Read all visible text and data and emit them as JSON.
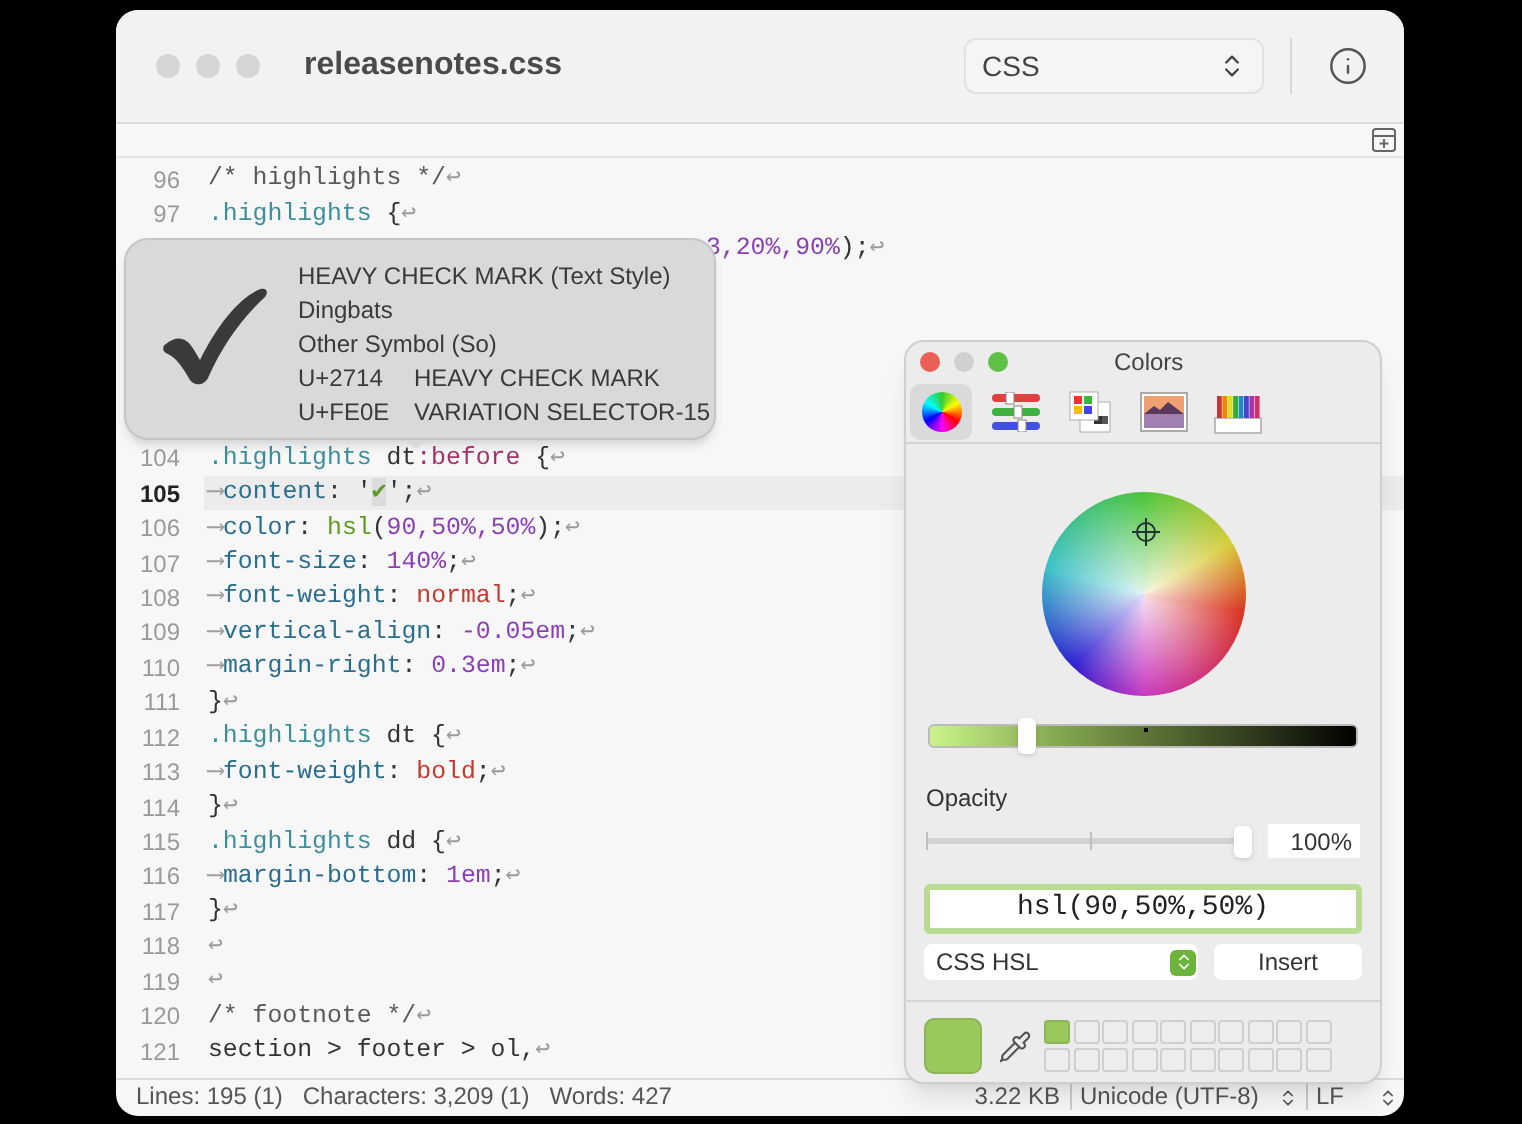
{
  "window": {
    "title": "releasenotes.css",
    "syntax": "CSS"
  },
  "lines": [
    {
      "number": "96",
      "current": false,
      "tokens": [
        {
          "text": "/* highlights */",
          "kind": "comment"
        },
        {
          "text": "↩",
          "kind": "eol"
        }
      ]
    },
    {
      "number": "97",
      "current": false,
      "tokens": [
        {
          "text": ".highlights",
          "kind": "selector"
        },
        {
          "text": " {",
          "kind": "plain"
        },
        {
          "text": "↩",
          "kind": "eol"
        }
      ]
    },
    {
      "covered": true,
      "current": false,
      "tokens": [
        {
          "text": "3,20%,90%",
          "kind": "number"
        },
        {
          "text": ");",
          "kind": "plain"
        },
        {
          "text": "↩",
          "kind": "eol"
        }
      ]
    },
    {
      "covered": true
    },
    {
      "covered": true
    },
    {
      "covered": true
    },
    {
      "covered": true
    },
    {
      "covered": true
    },
    {
      "number": "104",
      "current": false,
      "tokens": [
        {
          "text": ".highlights",
          "kind": "selector"
        },
        {
          "text": " dt",
          "kind": "plain"
        },
        {
          "text": ":before",
          "kind": "pseudo"
        },
        {
          "text": " {",
          "kind": "plain"
        },
        {
          "text": "↩",
          "kind": "eol"
        }
      ]
    },
    {
      "number": "105",
      "current": true,
      "tokens": [
        {
          "text": "⟶",
          "kind": "tab"
        },
        {
          "text": "content",
          "kind": "property"
        },
        {
          "text": ": '",
          "kind": "plain"
        },
        {
          "text": "✔",
          "kind": "glyph"
        },
        {
          "text": "';",
          "kind": "plain"
        },
        {
          "text": "↩",
          "kind": "eol"
        }
      ]
    },
    {
      "number": "106",
      "current": false,
      "tokens": [
        {
          "text": "⟶",
          "kind": "tab"
        },
        {
          "text": "color",
          "kind": "property"
        },
        {
          "text": ": ",
          "kind": "plain"
        },
        {
          "text": "hsl",
          "kind": "function"
        },
        {
          "text": "(",
          "kind": "plain"
        },
        {
          "text": "90,50%,50%",
          "kind": "number"
        },
        {
          "text": ");",
          "kind": "plain"
        },
        {
          "text": "↩",
          "kind": "eol"
        }
      ]
    },
    {
      "number": "107",
      "current": false,
      "tokens": [
        {
          "text": "⟶",
          "kind": "tab"
        },
        {
          "text": "font-size",
          "kind": "property"
        },
        {
          "text": ": ",
          "kind": "plain"
        },
        {
          "text": "140%",
          "kind": "number"
        },
        {
          "text": ";",
          "kind": "plain"
        },
        {
          "text": "↩",
          "kind": "eol"
        }
      ]
    },
    {
      "number": "108",
      "current": false,
      "tokens": [
        {
          "text": "⟶",
          "kind": "tab"
        },
        {
          "text": "font-weight",
          "kind": "property"
        },
        {
          "text": ": ",
          "kind": "plain"
        },
        {
          "text": "normal",
          "kind": "keyword"
        },
        {
          "text": ";",
          "kind": "plain"
        },
        {
          "text": "↩",
          "kind": "eol"
        }
      ]
    },
    {
      "number": "109",
      "current": false,
      "tokens": [
        {
          "text": "⟶",
          "kind": "tab"
        },
        {
          "text": "vertical-align",
          "kind": "property"
        },
        {
          "text": ": ",
          "kind": "plain"
        },
        {
          "text": "-0.05em",
          "kind": "number"
        },
        {
          "text": ";",
          "kind": "plain"
        },
        {
          "text": "↩",
          "kind": "eol"
        }
      ]
    },
    {
      "number": "110",
      "current": false,
      "tokens": [
        {
          "text": "⟶",
          "kind": "tab"
        },
        {
          "text": "margin-right",
          "kind": "property"
        },
        {
          "text": ": ",
          "kind": "plain"
        },
        {
          "text": "0.3em",
          "kind": "number"
        },
        {
          "text": ";",
          "kind": "plain"
        },
        {
          "text": "↩",
          "kind": "eol"
        }
      ]
    },
    {
      "number": "111",
      "current": false,
      "tokens": [
        {
          "text": "}",
          "kind": "plain"
        },
        {
          "text": "↩",
          "kind": "eol"
        }
      ]
    },
    {
      "number": "112",
      "current": false,
      "tokens": [
        {
          "text": ".highlights",
          "kind": "selector"
        },
        {
          "text": " dt {",
          "kind": "plain"
        },
        {
          "text": "↩",
          "kind": "eol"
        }
      ]
    },
    {
      "number": "113",
      "current": false,
      "tokens": [
        {
          "text": "⟶",
          "kind": "tab"
        },
        {
          "text": "font-weight",
          "kind": "property"
        },
        {
          "text": ": ",
          "kind": "plain"
        },
        {
          "text": "bold",
          "kind": "keyword"
        },
        {
          "text": ";",
          "kind": "plain"
        },
        {
          "text": "↩",
          "kind": "eol"
        }
      ]
    },
    {
      "number": "114",
      "current": false,
      "tokens": [
        {
          "text": "}",
          "kind": "plain"
        },
        {
          "text": "↩",
          "kind": "eol"
        }
      ]
    },
    {
      "number": "115",
      "current": false,
      "tokens": [
        {
          "text": ".highlights",
          "kind": "selector"
        },
        {
          "text": " dd {",
          "kind": "plain"
        },
        {
          "text": "↩",
          "kind": "eol"
        }
      ]
    },
    {
      "number": "116",
      "current": false,
      "tokens": [
        {
          "text": "⟶",
          "kind": "tab"
        },
        {
          "text": "margin-bottom",
          "kind": "property"
        },
        {
          "text": ": ",
          "kind": "plain"
        },
        {
          "text": "1em",
          "kind": "number"
        },
        {
          "text": ";",
          "kind": "plain"
        },
        {
          "text": "↩",
          "kind": "eol"
        }
      ]
    },
    {
      "number": "117",
      "current": false,
      "tokens": [
        {
          "text": "}",
          "kind": "plain"
        },
        {
          "text": "↩",
          "kind": "eol"
        }
      ]
    },
    {
      "number": "118",
      "current": false,
      "tokens": [
        {
          "text": "↩",
          "kind": "eol"
        }
      ]
    },
    {
      "number": "119",
      "current": false,
      "tokens": [
        {
          "text": "↩",
          "kind": "eol"
        }
      ]
    },
    {
      "number": "120",
      "current": false,
      "tokens": [
        {
          "text": "/* footnote */",
          "kind": "comment"
        },
        {
          "text": "↩",
          "kind": "eol"
        }
      ]
    },
    {
      "number": "121",
      "current": false,
      "tokens": [
        {
          "text": "section > footer > ol,",
          "kind": "plain"
        },
        {
          "text": "↩",
          "kind": "eol"
        }
      ]
    }
  ],
  "character_info": {
    "name": "HEAVY CHECK MARK (Text Style)",
    "block": "Dingbats",
    "category": "Other Symbol (So)",
    "code_points": [
      {
        "code": "U+2714",
        "name": "HEAVY CHECK MARK"
      },
      {
        "code": "U+FE0E",
        "name": "VARIATION SELECTOR-15"
      }
    ]
  },
  "colors_panel": {
    "title": "Colors",
    "modes": [
      {
        "kind": "wheel",
        "selected": true
      },
      {
        "kind": "sliders",
        "selected": false
      },
      {
        "kind": "palettes",
        "selected": false
      },
      {
        "kind": "image",
        "selected": false
      },
      {
        "kind": "pencils",
        "selected": false
      }
    ],
    "brightness": {
      "level": 0.23
    },
    "opacity": {
      "label": "Opacity",
      "level": 1,
      "value": "100%"
    },
    "color_value": "hsl(90,50%,50%)",
    "format": "CSS HSL",
    "insert_button": "Insert",
    "swatches": [
      {
        "empty": false,
        "color": "#9bc85a"
      },
      {
        "empty": true
      },
      {
        "empty": true
      },
      {
        "empty": true
      },
      {
        "empty": true
      },
      {
        "empty": true
      },
      {
        "empty": true
      },
      {
        "empty": true
      },
      {
        "empty": true
      },
      {
        "empty": true
      },
      {
        "empty": true
      },
      {
        "empty": true
      },
      {
        "empty": true
      },
      {
        "empty": true
      },
      {
        "empty": true
      },
      {
        "empty": true
      },
      {
        "empty": true
      },
      {
        "empty": true
      },
      {
        "empty": true
      },
      {
        "empty": true
      }
    ]
  },
  "status_bar": {
    "lines": "Lines: 195 (1)",
    "characters": "Characters: 3,209 (1)",
    "words": "Words: 427",
    "size": "3.22 KB",
    "encoding": "Unicode (UTF-8)",
    "line_endings": "LF"
  }
}
